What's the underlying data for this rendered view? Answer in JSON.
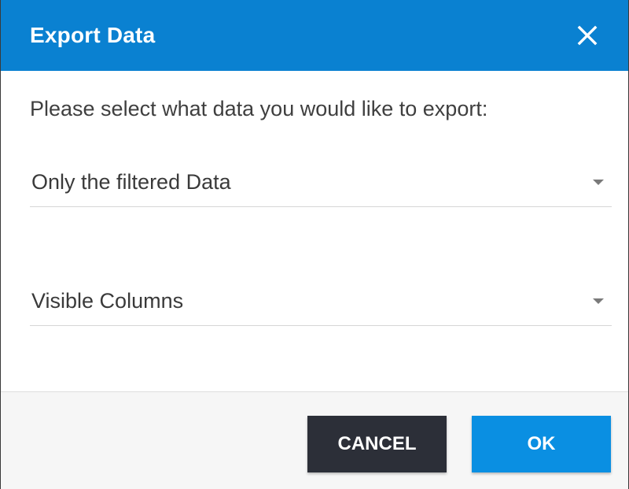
{
  "dialog": {
    "title": "Export Data",
    "close_icon": "close-icon",
    "prompt": "Please select what data you would like to export:",
    "data_scope_select": {
      "selected": "Only the filtered Data",
      "icon": "caret-down-icon"
    },
    "columns_select": {
      "selected": "Visible Columns",
      "icon": "caret-down-icon"
    },
    "buttons": {
      "cancel_label": "CANCEL",
      "ok_label": "OK"
    }
  },
  "colors": {
    "header_bg": "#0a81d1",
    "cancel_bg": "#2c2f38",
    "ok_bg": "#0a8fe2",
    "footer_bg": "#f6f6f6"
  }
}
